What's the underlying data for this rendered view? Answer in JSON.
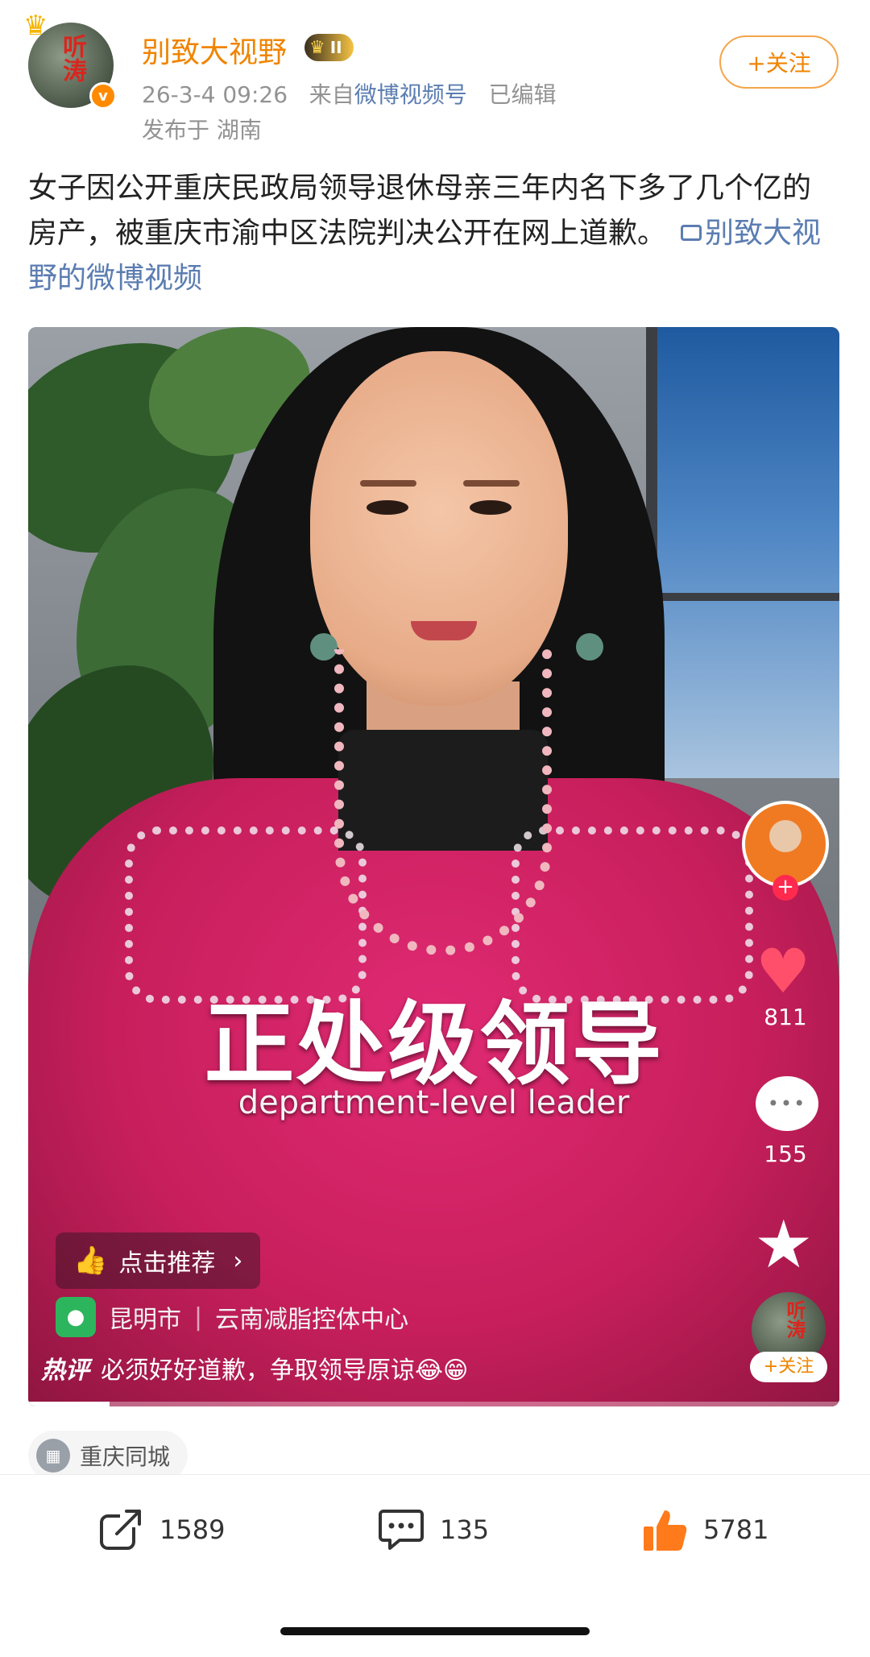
{
  "author": {
    "name": "别致大视野",
    "vip_level": "II",
    "avatar_seal": "听涛",
    "timestamp": "26-3-4 09:26",
    "source_prefix": "来自",
    "source": "微博视频号",
    "edited": "已编辑",
    "location": "发布于 湖南",
    "follow_label": "+关注"
  },
  "post": {
    "text": "女子因公开重庆民政局领导退休母亲三年内名下多了几个亿的房产，被重庆市渝中区法院判决公开在网上道歉。",
    "video_link": "别致大视野的微博视频"
  },
  "video": {
    "subtitle_cn": "正处级领导",
    "subtitle_en": "department-level leader",
    "like_count": "811",
    "comment_count": "155",
    "follow_label": "+关注",
    "recommend_label": "点击推荐",
    "location_city": "昆明市",
    "location_place": "云南减脂控体中心",
    "hot_tag": "热评",
    "hot_comment": "必须好好道歉，争取领导原谅😂😁",
    "progress": 0.1
  },
  "topic": {
    "label": "重庆同城"
  },
  "actions": {
    "repost_count": "1589",
    "comment_count": "135",
    "like_count": "5781"
  },
  "colors": {
    "accent": "#f08400",
    "link": "#5b7db1",
    "like": "#ff7a1a"
  }
}
